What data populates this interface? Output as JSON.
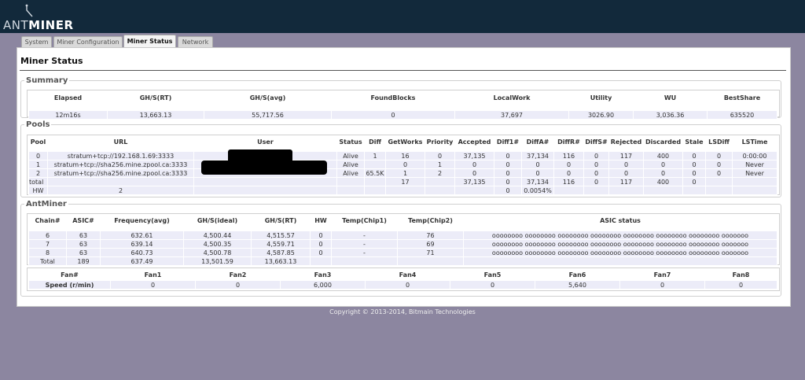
{
  "brand": {
    "light": "ANT",
    "bold": "MINER"
  },
  "tabs": [
    {
      "label": "System"
    },
    {
      "label": "Miner Configuration"
    },
    {
      "label": "Miner Status"
    },
    {
      "label": "Network"
    }
  ],
  "page_title": "Miner Status",
  "summary": {
    "legend": "Summary",
    "headers": [
      "Elapsed",
      "GH/S(RT)",
      "GH/S(avg)",
      "FoundBlocks",
      "LocalWork",
      "Utility",
      "WU",
      "BestShare"
    ],
    "values": [
      "12m16s",
      "13,663.13",
      "55,717.56",
      "0",
      "37,697",
      "3026.90",
      "3,036.36",
      "635520"
    ]
  },
  "pools": {
    "legend": "Pools",
    "headers": [
      "Pool",
      "URL",
      "User",
      "Status",
      "Diff",
      "GetWorks",
      "Priority",
      "Accepted",
      "Diff1#",
      "DiffA#",
      "DiffR#",
      "DiffS#",
      "Rejected",
      "Discarded",
      "Stale",
      "LSDiff",
      "LSTime"
    ],
    "rows": [
      [
        "0",
        "stratum+tcp://192.168.1.69:3333",
        "",
        "Alive",
        "1",
        "16",
        "0",
        "37,135",
        "0",
        "37,134",
        "116",
        "0",
        "117",
        "400",
        "0",
        "0",
        "0:00:00"
      ],
      [
        "1",
        "stratum+tcp://sha256.mine.zpool.ca:3333",
        "",
        "Alive",
        "",
        "0",
        "1",
        "0",
        "0",
        "0",
        "0",
        "0",
        "0",
        "0",
        "0",
        "0",
        "Never"
      ],
      [
        "2",
        "stratum+tcp://sha256.mine.zpool.ca:3333",
        "",
        "Alive",
        "65.5K",
        "1",
        "2",
        "0",
        "0",
        "0",
        "0",
        "0",
        "0",
        "0",
        "0",
        "0",
        "Never"
      ],
      [
        "total",
        "",
        "",
        "",
        "",
        "17",
        "",
        "37,135",
        "0",
        "37,134",
        "116",
        "0",
        "117",
        "400",
        "0",
        "",
        ""
      ],
      [
        "HW",
        "2",
        "",
        "",
        "",
        "",
        "",
        "",
        "0",
        "0.0054%",
        "",
        "",
        "",
        "",
        "",
        "",
        ""
      ]
    ]
  },
  "antminer": {
    "legend": "AntMiner",
    "headers": [
      "Chain#",
      "ASIC#",
      "Frequency(avg)",
      "GH/S(ideal)",
      "GH/S(RT)",
      "HW",
      "Temp(Chip1)",
      "Temp(Chip2)",
      "ASIC status"
    ],
    "rows": [
      [
        "6",
        "63",
        "632.61",
        "4,500.44",
        "4,515.57",
        "0",
        "-",
        "76",
        "oooooooo oooooooo oooooooo oooooooo oooooooo oooooooo oooooooo ooooooo"
      ],
      [
        "7",
        "63",
        "639.14",
        "4,500.35",
        "4,559.71",
        "0",
        "-",
        "69",
        "oooooooo oooooooo oooooooo oooooooo oooooooo oooooooo oooooooo ooooooo"
      ],
      [
        "8",
        "63",
        "640.73",
        "4,500.78",
        "4,587.85",
        "0",
        "-",
        "71",
        "oooooooo oooooooo oooooooo oooooooo oooooooo oooooooo oooooooo ooooooo"
      ],
      [
        "Total",
        "189",
        "637.49",
        "13,501.59",
        "13,663.13",
        "",
        "",
        "",
        ""
      ]
    ],
    "fans": {
      "headers": [
        "Fan#",
        "Fan1",
        "Fan2",
        "Fan3",
        "Fan4",
        "Fan5",
        "Fan6",
        "Fan7",
        "Fan8"
      ],
      "values": [
        "Speed (r/min)",
        "0",
        "0",
        "6,000",
        "0",
        "0",
        "5,640",
        "0",
        "0"
      ]
    }
  },
  "footer": "Copyright © 2013-2014, Bitmain Technologies"
}
